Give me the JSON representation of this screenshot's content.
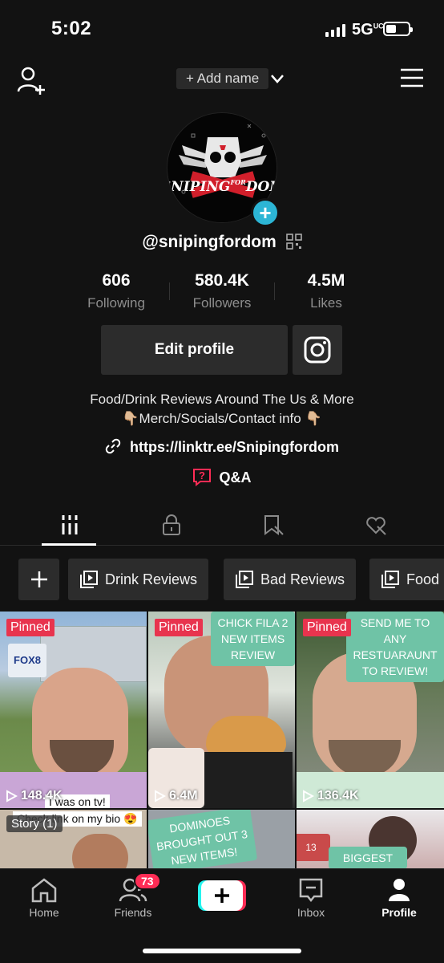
{
  "status_bar": {
    "time": "5:02",
    "network": "5G",
    "network_sub": "UC"
  },
  "header": {
    "add_name": "+ Add name"
  },
  "profile": {
    "username": "@snipingfordom",
    "avatar_text_top": "SNIPING",
    "avatar_text_mid": "FOR",
    "avatar_text_bottom": "DOM"
  },
  "stats": [
    {
      "value": "606",
      "label": "Following"
    },
    {
      "value": "580.4K",
      "label": "Followers"
    },
    {
      "value": "4.5M",
      "label": "Likes"
    }
  ],
  "buttons": {
    "edit_profile": "Edit profile"
  },
  "bio": {
    "line1": "Food/Drink Reviews Around The Us & More",
    "line2": "👇🏼Merch/Socials/Contact info 👇🏼",
    "link": "https://linktr.ee/Snipingfordom",
    "qa": "Q&A"
  },
  "playlists": [
    {
      "label": "Drink Reviews"
    },
    {
      "label": "Bad Reviews"
    },
    {
      "label": "Food"
    }
  ],
  "videos": [
    {
      "pinned": "Pinned",
      "views": "148.4K",
      "caption": "I was on tv!",
      "caption2": "Check link on my bio 😍",
      "story": "Story (1)",
      "sign": "FOX8"
    },
    {
      "pinned": "Pinned",
      "views": "6.4M",
      "bubble": "CHICK FILA 2 NEW ITEMS REVIEW"
    },
    {
      "pinned": "Pinned",
      "views": "136.4K",
      "bubble": "SEND ME TO ANY RESTUARAUNT TO REVIEW!"
    },
    {
      "bubble": "DOMINOES BROUGHT OUT 3 NEW ITEMS!"
    },
    {
      "repost_count": "13",
      "bubble": "BIGGEST"
    }
  ],
  "bottom_nav": [
    {
      "label": "Home"
    },
    {
      "label": "Friends",
      "badge": "73"
    },
    {
      "label": ""
    },
    {
      "label": "Inbox"
    },
    {
      "label": "Profile"
    }
  ],
  "colors": {
    "accent": "#fe2c55",
    "teal": "#2cb5d5",
    "bubble": "#6fc3a6"
  }
}
